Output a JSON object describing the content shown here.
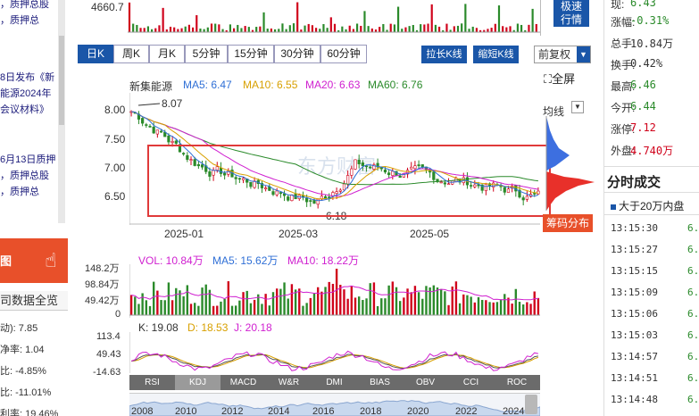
{
  "left": {
    "news": [
      "，质押总股",
      "，质押总",
      "8日发布《新",
      "能源2024年",
      "会议材料》",
      "6月13日质押",
      "，质押总股",
      "，质押总"
    ],
    "banner_text": "图",
    "section_title": "司数据全览",
    "ratios": [
      "动): 7.85",
      "净率: 1.04",
      "比: -4.85%",
      "比: -11.01%",
      "利率: 19.46%"
    ]
  },
  "top": {
    "vol_label": "4660.7",
    "fast_btn": [
      "极速",
      "行情"
    ]
  },
  "toolbar": {
    "periods": [
      "日K",
      "周K",
      "月K",
      "5分钟",
      "15分钟",
      "30分钟",
      "60分钟"
    ],
    "active": 0,
    "zoom_in": "拉长K线",
    "zoom_out": "缩短K线",
    "adjust": "前复权",
    "fullscreen": "全屏"
  },
  "kline": {
    "stock": "新集能源",
    "ma": [
      {
        "label": "MA5: 6.47",
        "color": "#2f6fd6"
      },
      {
        "label": "MA10: 6.55",
        "color": "#d8a000"
      },
      {
        "label": "MA20: 6.63",
        "color": "#d020d0"
      },
      {
        "label": "MA60: 6.76",
        "color": "#2a8a2a"
      }
    ],
    "y_ticks": [
      "8.00",
      "7.50",
      "7.00",
      "6.50"
    ],
    "x_ticks": [
      "2025-01",
      "2025-03",
      "2025-05"
    ],
    "high_mark": "8.07",
    "low_mark": "6.18",
    "watermark": "东方财富"
  },
  "volume": {
    "legend": [
      {
        "label": "VOL: 10.84万",
        "color": "#d020d0"
      },
      {
        "label": "MA5: 15.62万",
        "color": "#2f6fd6"
      },
      {
        "label": "MA10: 18.22万",
        "color": "#d020d0"
      }
    ],
    "y_ticks": [
      "148.2万",
      "98.84万",
      "49.42万",
      "0"
    ]
  },
  "kdj": {
    "legend": [
      {
        "label": "K: 19.08",
        "color": "#333333"
      },
      {
        "label": "D: 18.53",
        "color": "#d8a000"
      },
      {
        "label": "J: 20.18",
        "color": "#d020d0"
      }
    ],
    "y_ticks": [
      "113.4",
      "49.43",
      "-14.63"
    ]
  },
  "indicators": [
    "RSI",
    "KDJ",
    "MACD",
    "W&R",
    "DMI",
    "BIAS",
    "OBV",
    "CCI",
    "ROC"
  ],
  "active_indicator": 1,
  "timeline": [
    "2008",
    "2010",
    "2012",
    "2014",
    "2016",
    "2018",
    "2020",
    "2022",
    "2024"
  ],
  "chip": {
    "title": "均线",
    "label": "筹码分布"
  },
  "quote": [
    {
      "label": "涨幅:",
      "value": "-0.31%",
      "color": "#2a8a2a"
    },
    {
      "label": "总手:",
      "value": "10.84万",
      "color": "#333333"
    },
    {
      "label": "换手:",
      "value": "0.42%",
      "color": "#333333"
    },
    {
      "label": "最高:",
      "value": "6.46",
      "color": "#2a8a2a"
    },
    {
      "label": "今开:",
      "value": "6.44",
      "color": "#2a8a2a"
    },
    {
      "label": "涨停:",
      "value": "7.12",
      "color": "#d0021b"
    },
    {
      "label": "外盘:",
      "value": "4.740万",
      "color": "#d0021b"
    }
  ],
  "trades": {
    "title": "分时成交",
    "filter": "大于20万内盘",
    "rows": [
      {
        "time": "13:15:30",
        "value": "6."
      },
      {
        "time": "13:15:27",
        "value": "6."
      },
      {
        "time": "13:15:15",
        "value": "6."
      },
      {
        "time": "13:15:09",
        "value": "6."
      },
      {
        "time": "13:15:06",
        "value": "6."
      },
      {
        "time": "13:15:03",
        "value": "6."
      },
      {
        "time": "13:14:57",
        "value": "6."
      },
      {
        "time": "13:14:51",
        "value": "6."
      },
      {
        "time": "13:14:48",
        "value": "6."
      }
    ]
  }
}
